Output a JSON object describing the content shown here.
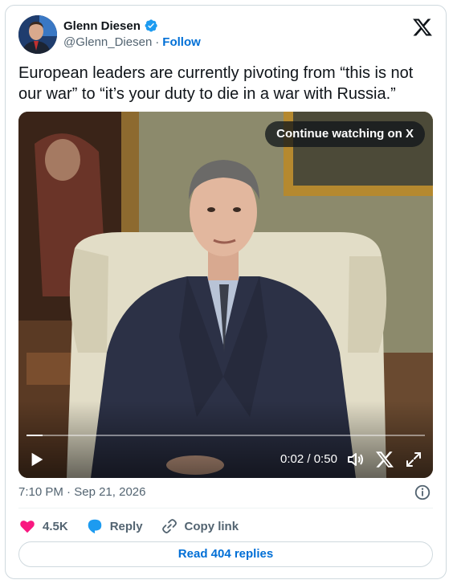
{
  "author": {
    "name": "Glenn Diesen",
    "handle": "@Glenn_Diesen",
    "separator": "·",
    "follow_label": "Follow",
    "verified_color": "#1d9bf0"
  },
  "tweet": {
    "text": "European leaders are currently pivoting from “this is not our war” to “it’s your duty to die in a war with Russia.”"
  },
  "video": {
    "continue_label": "Continue watching on X",
    "time_current": "0:02",
    "time_sep": " / ",
    "time_total": "0:50",
    "progress_fraction": 0.04
  },
  "meta": {
    "time": "7:10 PM",
    "separator": "·",
    "date": "Sep 21, 2026"
  },
  "actions": {
    "likes_count": "4.5K",
    "reply_label": "Reply",
    "copy_label": "Copy link",
    "like_color": "#f91880",
    "reply_color": "#1d9bf0"
  },
  "read_replies_label": "Read 404 replies"
}
